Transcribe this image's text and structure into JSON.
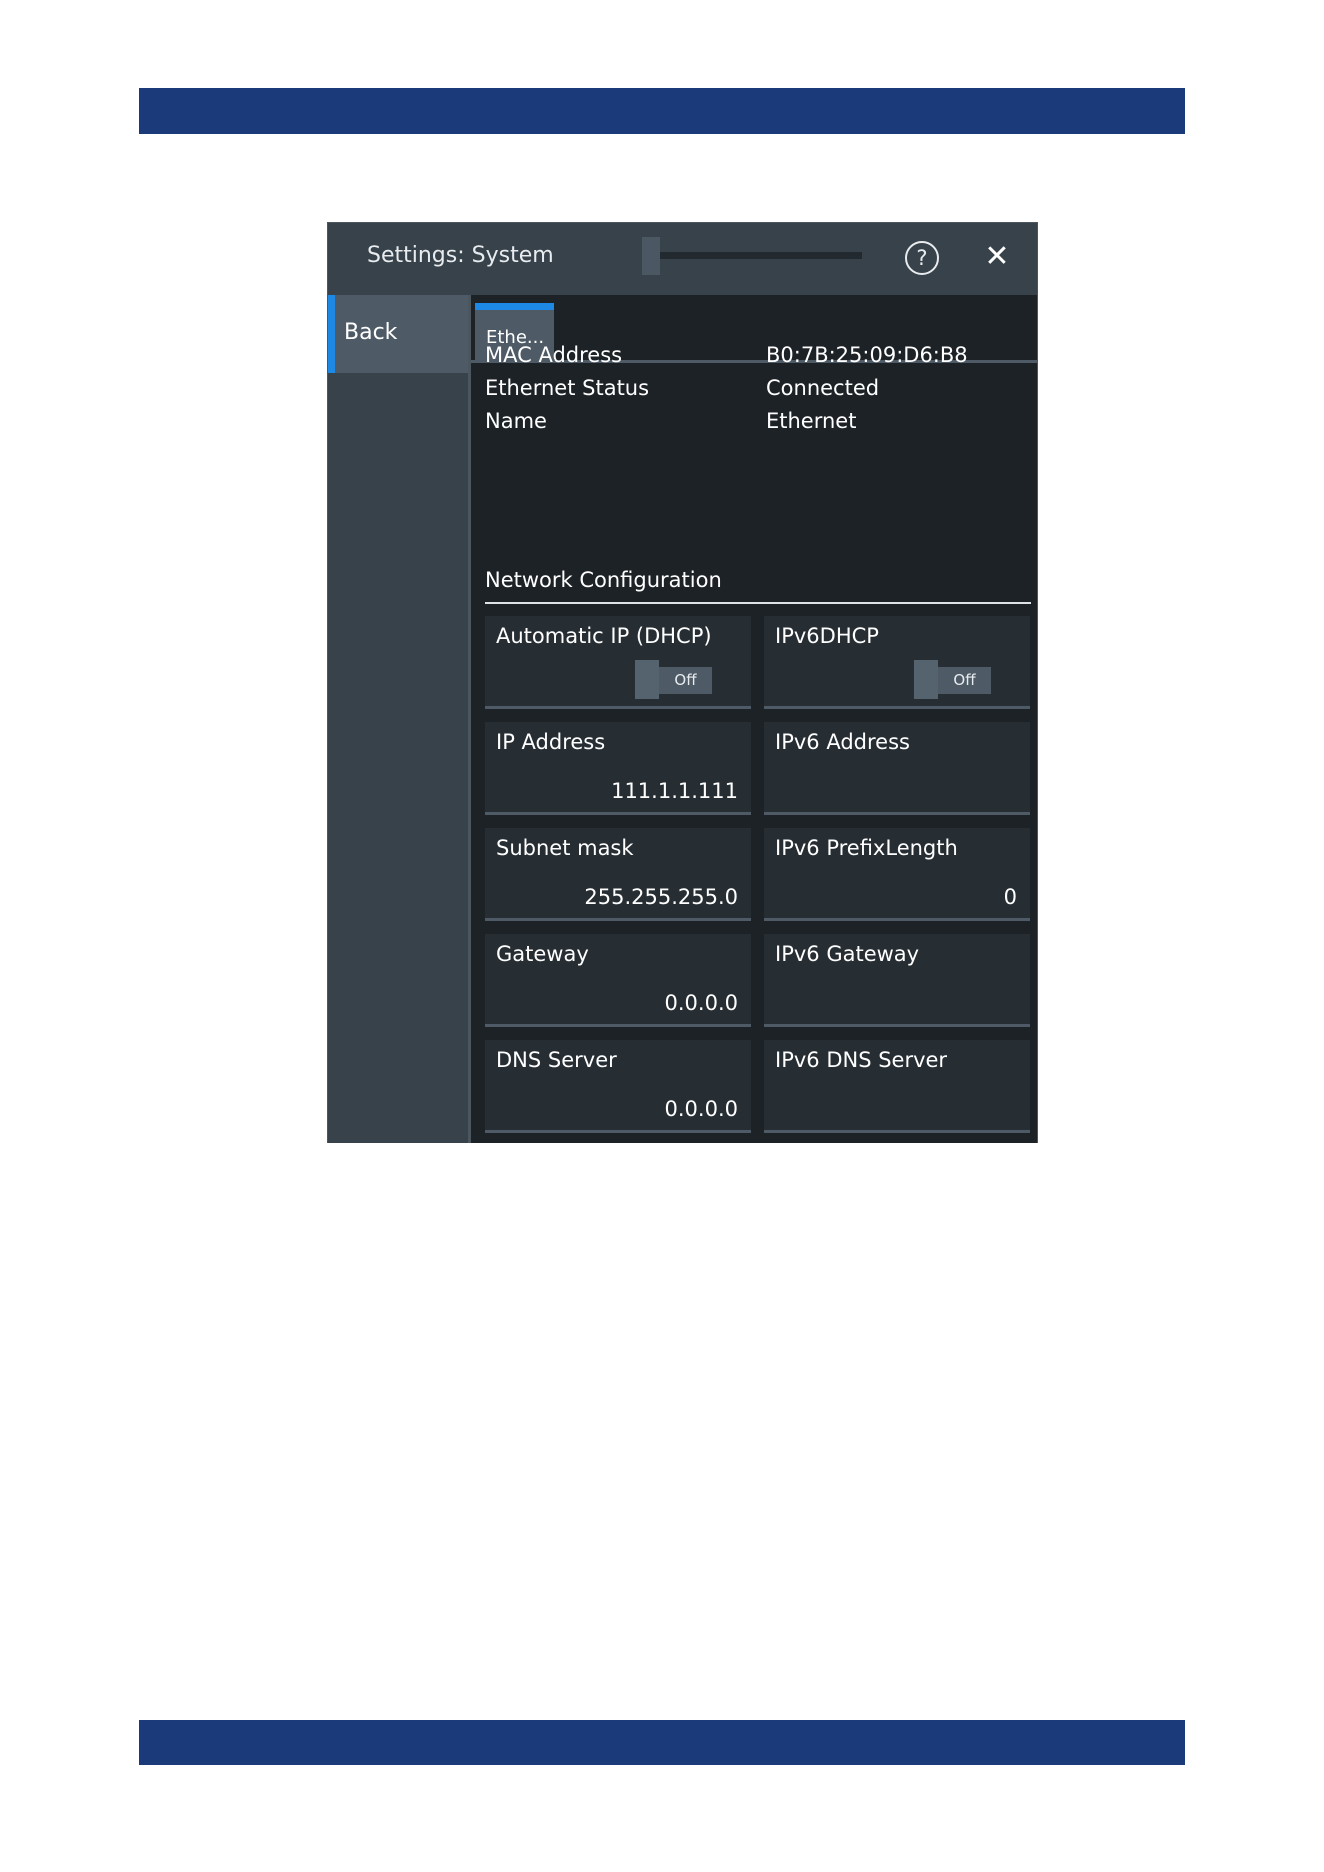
{
  "dialog": {
    "title": "Settings: System",
    "help_glyph": "?",
    "close_glyph": "✕"
  },
  "sidebar": {
    "back_label": "Back"
  },
  "tabs": [
    {
      "label": "Ethe..."
    }
  ],
  "info": {
    "mac_label": "MAC Address",
    "mac_value": "B0:7B:25:09:D6:B8",
    "status_label": "Ethernet Status",
    "status_value": "Connected",
    "name_label": "Name",
    "name_value": "Ethernet"
  },
  "network": {
    "title": "Network Configuration",
    "dhcp": {
      "label": "Automatic IP (DHCP)",
      "state": "Off"
    },
    "ipv6dhcp": {
      "label": "IPv6DHCP",
      "state": "Off"
    },
    "ip_address": {
      "label": "IP Address",
      "value": "111.1.1.111"
    },
    "ipv6_address": {
      "label": "IPv6 Address",
      "value": ""
    },
    "subnet_mask": {
      "label": "Subnet mask",
      "value": "255.255.255.0"
    },
    "ipv6_prefix": {
      "label": "IPv6 PrefixLength",
      "value": "0"
    },
    "gateway": {
      "label": "Gateway",
      "value": "0.0.0.0"
    },
    "ipv6_gateway": {
      "label": "IPv6 Gateway",
      "value": ""
    },
    "dns_server": {
      "label": "DNS Server",
      "value": "0.0.0.0"
    },
    "ipv6_dns": {
      "label": "IPv6 DNS Server",
      "value": ""
    }
  },
  "colors": {
    "header_band": "#1b3a7a",
    "accent": "#1e88e5",
    "panel": "#1d2227",
    "field": "#262e34"
  }
}
